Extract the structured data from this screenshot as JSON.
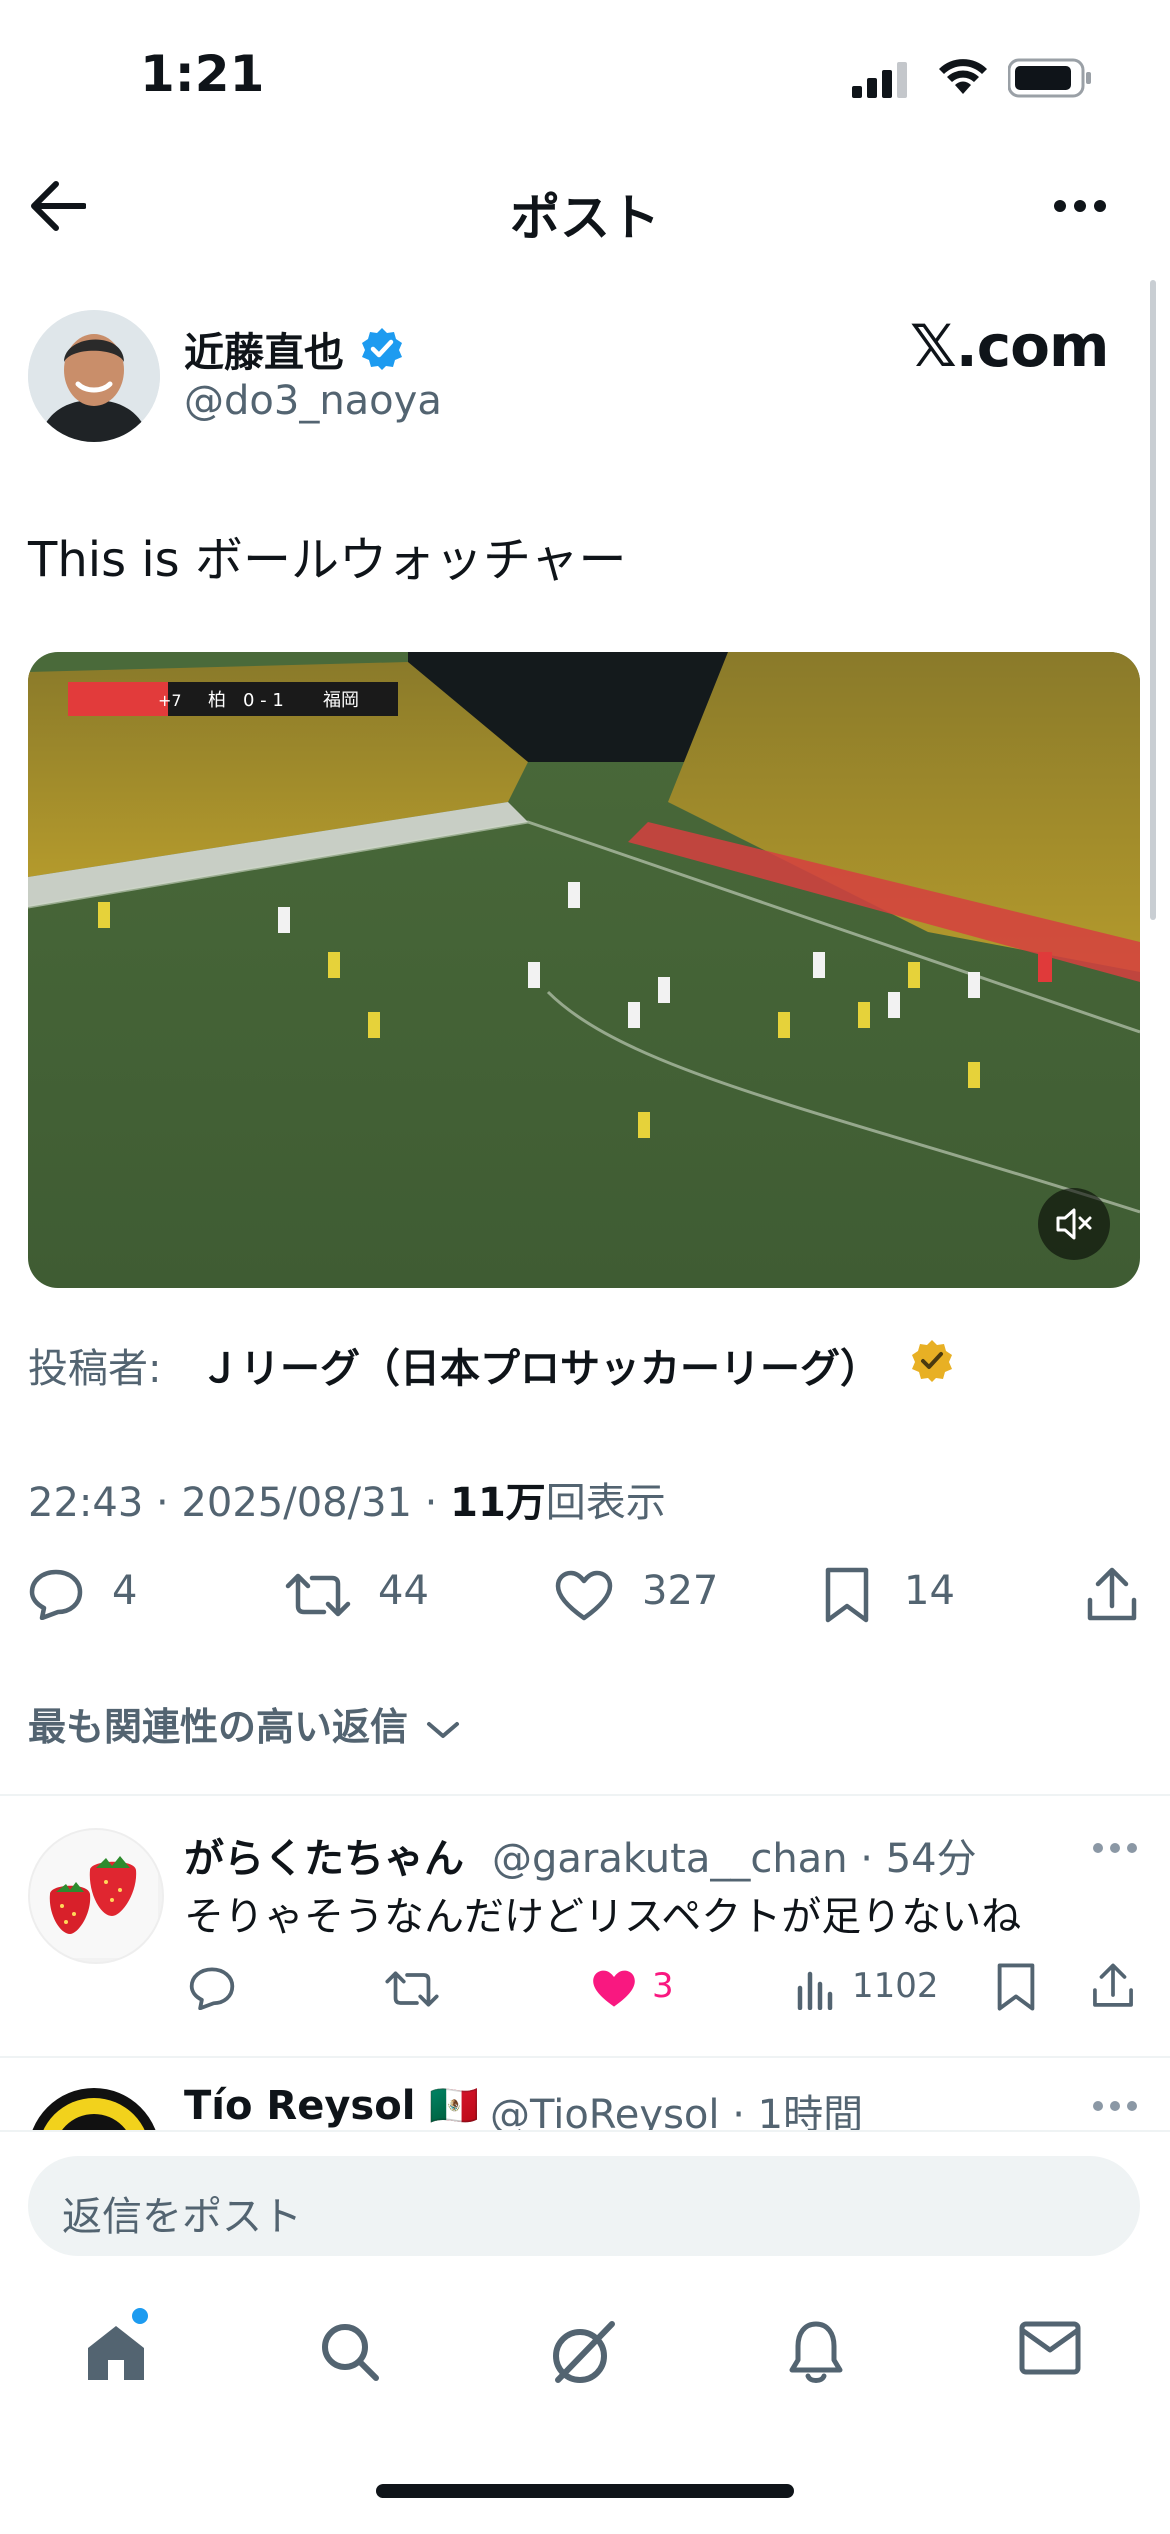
{
  "status_bar": {
    "time": "1:21"
  },
  "header": {
    "title": "ポスト"
  },
  "post": {
    "author_name": "近藤直也",
    "author_handle": "@do3_naoya",
    "source_logo": "𝕏.com",
    "text": "This is ボールウォッチャー",
    "poster_label": "投稿者:",
    "poster_name": "Ｊリーグ（日本プロサッカーリーグ）",
    "timestamp": "22:43 · 2025/08/31 · ",
    "views_number": "11万",
    "views_label": "回表示",
    "stats": {
      "replies": "4",
      "reposts": "44",
      "likes": "327",
      "bookmarks": "14"
    },
    "scoreboard": {
      "team_home": "柏",
      "score_home": "0",
      "score_away": "1",
      "team_away": "福岡",
      "badge": "+7"
    }
  },
  "replies_filter": {
    "label": "最も関連性の高い返信"
  },
  "replies": [
    {
      "name": "がらくたちゃん",
      "handle_time": "@garakuta__chan · 54分",
      "text": "そりゃそうなんだけどリスペクトが足りないね",
      "likes": "3",
      "views": "1102"
    },
    {
      "name": "Tío Reysol 🇲🇽",
      "handle_time": "@TioReysol · 1時間"
    }
  ],
  "composer": {
    "placeholder": "返信をポスト"
  },
  "tabs": [
    "home-icon",
    "search-icon",
    "grok-icon",
    "notifications-icon",
    "messages-icon"
  ],
  "colors": {
    "accent": "#1d9bf0",
    "like": "#f91880",
    "gold": "#e8b024",
    "text_secondary": "#536471"
  }
}
